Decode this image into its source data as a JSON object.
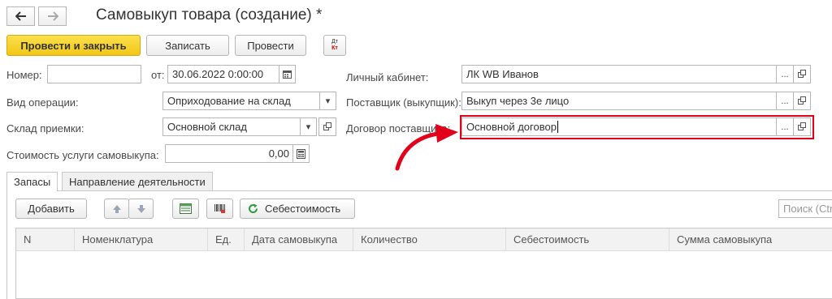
{
  "title": "Самовыкуп товара (создание) *",
  "nav": {
    "back_icon": "arrow-left",
    "forward_icon": "arrow-right"
  },
  "toolbar": {
    "post_close": "Провести и закрыть",
    "save": "Записать",
    "post": "Провести",
    "dt_kt_top": "Дт",
    "dt_kt_bottom": "Кт"
  },
  "form": {
    "number_label": "Номер:",
    "number_value": "",
    "date_label": "от:",
    "date_value": "30.06.2022  0:00:00",
    "cabinet_label": "Личный кабинет:",
    "cabinet_value": "ЛК WB Иванов",
    "operation_label": "Вид операции:",
    "operation_value": "Оприходование на склад",
    "supplier_label": "Поставщик (выкупщик):",
    "supplier_value": "Выкуп через 3е лицо",
    "warehouse_label": "Склад приемки:",
    "warehouse_value": "Основной склад",
    "contract_label": "Договор поставщика:",
    "contract_value": "Основной договор",
    "cost_label": "Стоимость услуги самовыкупа:",
    "cost_value": "0,00",
    "dots": "...",
    "dropdown_arrow": "▾"
  },
  "tabs": [
    {
      "label": "Запасы",
      "active": true
    },
    {
      "label": "Направление деятельности",
      "active": false
    }
  ],
  "table_toolbar": {
    "add": "Добавить",
    "cost_price": "Себестоимость",
    "search_placeholder": "Поиск (Ctrl+F)"
  },
  "table": {
    "columns": [
      "N",
      "Номенклатура",
      "Ед.",
      "Дата самовыкупа",
      "Количество",
      "Себестоимость",
      "Сумма самовыкупа"
    ],
    "rows": []
  },
  "colors": {
    "accent_yellow": "#f5cc1f",
    "highlight_red": "#e3001b"
  }
}
